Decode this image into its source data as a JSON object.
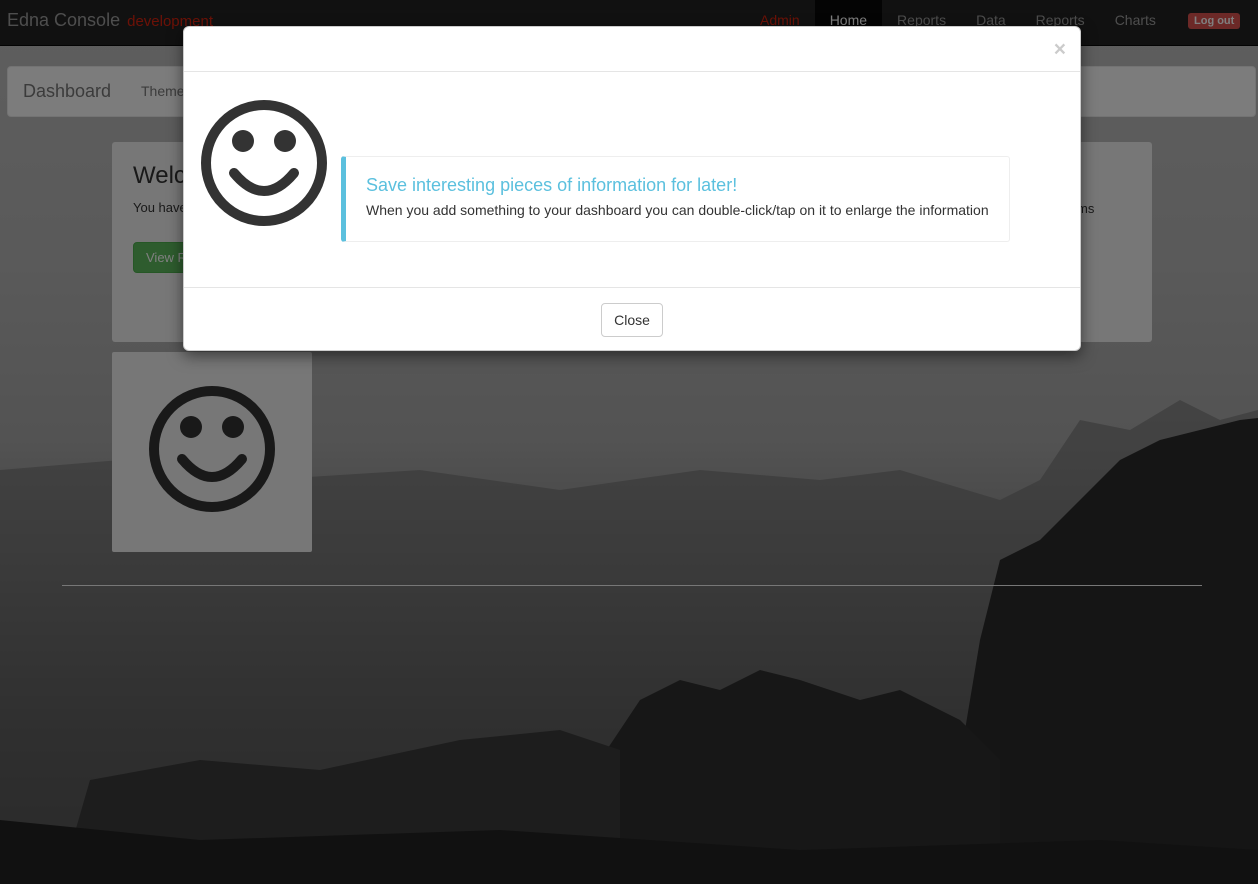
{
  "navbar": {
    "brand": "Edna Console",
    "environment": "development",
    "items": [
      {
        "label": "Admin",
        "type": "admin"
      },
      {
        "label": "Home",
        "type": "active"
      },
      {
        "label": "Reports",
        "type": "normal"
      },
      {
        "label": "Data",
        "type": "normal"
      },
      {
        "label": "Reports",
        "type": "normal"
      },
      {
        "label": "Charts",
        "type": "normal"
      }
    ],
    "logout_label": "Log out"
  },
  "subnav": {
    "title": "Dashboard",
    "theme_label": "Theme"
  },
  "welcome": {
    "heading": "Welc",
    "text": "You have",
    "right_text": "ms",
    "button_label": "View R"
  },
  "tile": {
    "icon": "smiley-icon"
  },
  "modal": {
    "close_symbol": "×",
    "icon": "smiley-icon",
    "callout_title": "Save interesting pieces of information for later!",
    "callout_text": "When you add something to your dashboard you can double-click/tap on it to enlarge the information",
    "close_button_label": "Close"
  },
  "colors": {
    "info": "#5bc0de",
    "danger": "#d9534f",
    "success": "#5cb85c",
    "navbar": "#222222"
  }
}
